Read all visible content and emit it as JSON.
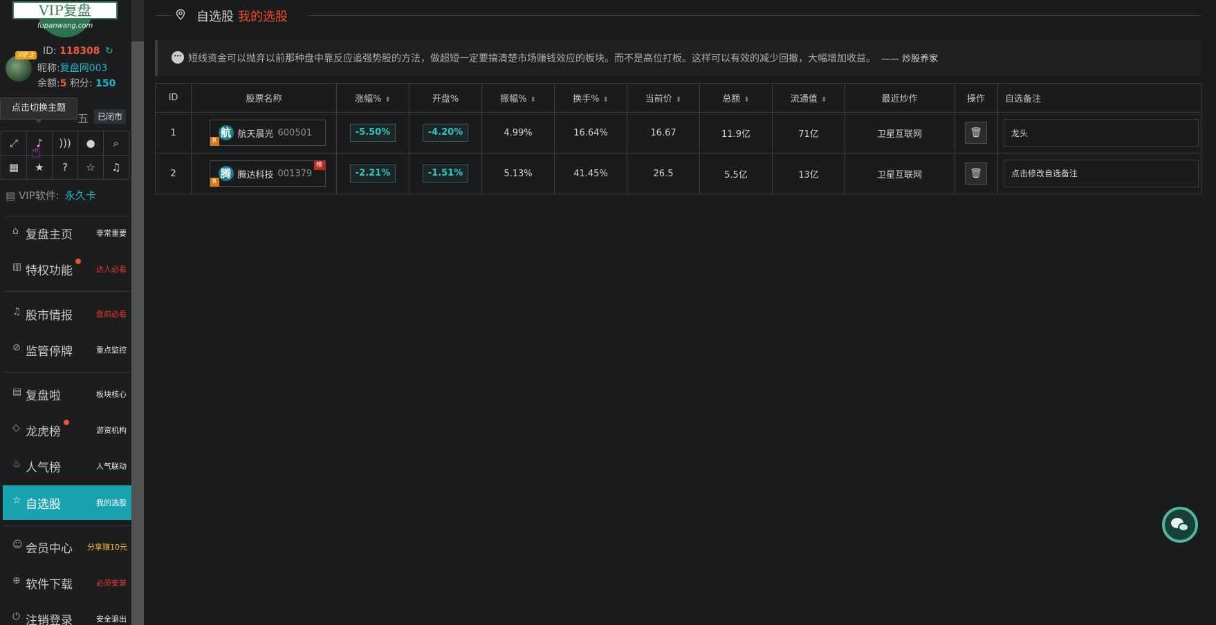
{
  "sidebar": {
    "logo_text": "VIP复盘",
    "logo_sub": "fupanwang.com",
    "vip_badge": "VIP 3",
    "id_label": "ID:",
    "id_value": "118308",
    "nickname_label": "昵称:",
    "nickname_value": "复盘网003",
    "balance_label": "余额:",
    "balance_value": "5",
    "points_label": "积分:",
    "points_value": "150",
    "tooltip": "点击切换主题",
    "weekday": "五",
    "market_status": "已闭市",
    "vip_software_label": "VIP软件:",
    "vip_software_value": "永久卡",
    "nav": [
      {
        "label": "复盘主页",
        "sub": "非常重要"
      },
      {
        "label": "特权功能",
        "sub": "达人必看"
      },
      {
        "label": "股市情报",
        "sub": "盘前必看"
      },
      {
        "label": "监管停牌",
        "sub": "重点监控"
      },
      {
        "label": "复盘啦",
        "sub": "板块核心"
      },
      {
        "label": "龙虎榜",
        "sub": "游资机构"
      },
      {
        "label": "人气榜",
        "sub": "人气联动"
      },
      {
        "label": "自选股",
        "sub": "我的选股"
      },
      {
        "label": "会员中心",
        "sub": "分享赚10元"
      },
      {
        "label": "软件下载",
        "sub": "必须安装"
      },
      {
        "label": "注销登录",
        "sub": "安全退出"
      }
    ]
  },
  "breadcrumb": {
    "title": "自选股",
    "subtitle": "我的选股"
  },
  "quote": {
    "text": "短线资金可以抛弃以前那种盘中靠反应追强势股的方法，做超短一定要搞清楚市场赚钱效应的板块。而不是高位打板。这样可以有效的减少回撤，大幅增加收益。",
    "author": "—— 炒股养家"
  },
  "table": {
    "headers": [
      "ID",
      "股票名称",
      "涨幅%",
      "开盘%",
      "振幅%",
      "换手%",
      "当前价",
      "总额",
      "流通值",
      "最近炒作",
      "操作",
      "自选备注"
    ],
    "rows": [
      {
        "id": "1",
        "char": "航",
        "name": "航天晨光",
        "code": "600501",
        "r": "R",
        "bang": "",
        "chg": "-5.50%",
        "open": "-4.20%",
        "amp": "4.99%",
        "turn": "16.64%",
        "price": "16.67",
        "total": "11.9亿",
        "float": "71亿",
        "hot": "卫星互联网",
        "note": "龙头"
      },
      {
        "id": "2",
        "char": "腾",
        "name": "腾达科技",
        "code": "001379",
        "r": "R",
        "bang": "榜",
        "chg": "-2.21%",
        "open": "-1.51%",
        "amp": "5.13%",
        "turn": "41.45%",
        "price": "26.5",
        "total": "5.5亿",
        "float": "13亿",
        "hot": "卫星互联网",
        "note": "点击修改自选备注"
      }
    ]
  },
  "colors": {
    "accent": "#19a3b0",
    "highlight": "#ef4d2b",
    "change": "#2fc6c6"
  }
}
